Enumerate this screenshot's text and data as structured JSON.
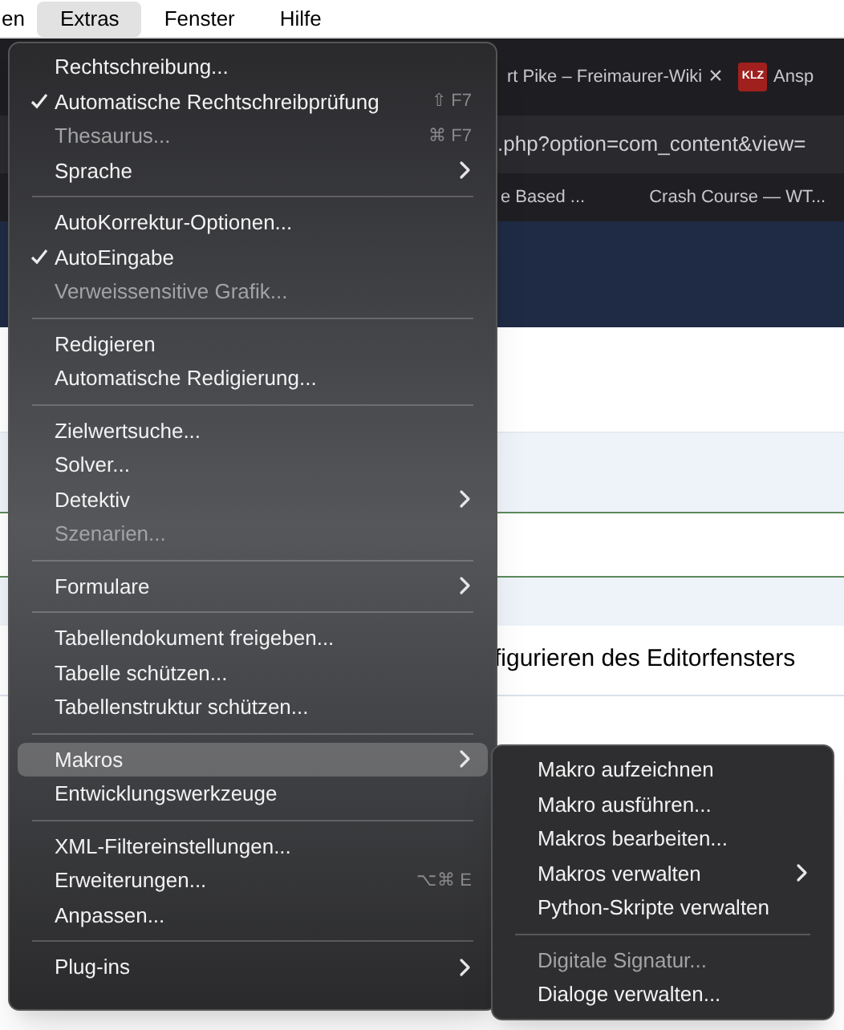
{
  "menubar": [
    {
      "label": "en",
      "selected": false
    },
    {
      "label": "Extras",
      "selected": true
    },
    {
      "label": "Fenster",
      "selected": false
    },
    {
      "label": "Hilfe",
      "selected": false
    }
  ],
  "browser": {
    "tabs": [
      {
        "kind": "text",
        "label": "rt Pike – Freimaurer-Wiki",
        "close": "×"
      },
      {
        "kind": "logo",
        "badge": "KLZ",
        "label": "Ansp"
      }
    ],
    "url": ".php?option=com_content&view=",
    "bookmarks": [
      "e Based ...",
      "Crash Course — WT..."
    ],
    "page_text": "figurieren des Editorfensters"
  },
  "menu": {
    "items": [
      {
        "kind": "item",
        "label": "Rechtschreibung...",
        "checked": false,
        "disabled": false,
        "selected": false,
        "submenu": false
      },
      {
        "kind": "item",
        "label": "Automatische Rechtschreibprüfung",
        "checked": true,
        "disabled": false,
        "selected": false,
        "submenu": false,
        "shortcut": "⇧ F7"
      },
      {
        "kind": "item",
        "label": "Thesaurus...",
        "checked": false,
        "disabled": true,
        "selected": false,
        "submenu": false,
        "shortcut": "⌘ F7"
      },
      {
        "kind": "item",
        "label": "Sprache",
        "checked": false,
        "disabled": false,
        "selected": false,
        "submenu": true
      },
      {
        "kind": "separator"
      },
      {
        "kind": "item",
        "label": "AutoKorrektur-Optionen...",
        "checked": false,
        "disabled": false,
        "selected": false,
        "submenu": false
      },
      {
        "kind": "item",
        "label": "AutoEingabe",
        "checked": true,
        "disabled": false,
        "selected": false,
        "submenu": false
      },
      {
        "kind": "item",
        "label": "Verweissensitive Grafik...",
        "checked": false,
        "disabled": true,
        "selected": false,
        "submenu": false
      },
      {
        "kind": "separator"
      },
      {
        "kind": "item",
        "label": "Redigieren",
        "checked": false,
        "disabled": false,
        "selected": false,
        "submenu": false
      },
      {
        "kind": "item",
        "label": "Automatische Redigierung...",
        "checked": false,
        "disabled": false,
        "selected": false,
        "submenu": false
      },
      {
        "kind": "separator"
      },
      {
        "kind": "item",
        "label": "Zielwertsuche...",
        "checked": false,
        "disabled": false,
        "selected": false,
        "submenu": false
      },
      {
        "kind": "item",
        "label": "Solver...",
        "checked": false,
        "disabled": false,
        "selected": false,
        "submenu": false
      },
      {
        "kind": "item",
        "label": "Detektiv",
        "checked": false,
        "disabled": false,
        "selected": false,
        "submenu": true
      },
      {
        "kind": "item",
        "label": "Szenarien...",
        "checked": false,
        "disabled": true,
        "selected": false,
        "submenu": false
      },
      {
        "kind": "separator"
      },
      {
        "kind": "item",
        "label": "Formulare",
        "checked": false,
        "disabled": false,
        "selected": false,
        "submenu": true
      },
      {
        "kind": "separator"
      },
      {
        "kind": "item",
        "label": "Tabellendokument freigeben...",
        "checked": false,
        "disabled": false,
        "selected": false,
        "submenu": false
      },
      {
        "kind": "item",
        "label": "Tabelle schützen...",
        "checked": false,
        "disabled": false,
        "selected": false,
        "submenu": false
      },
      {
        "kind": "item",
        "label": "Tabellenstruktur schützen...",
        "checked": false,
        "disabled": false,
        "selected": false,
        "submenu": false
      },
      {
        "kind": "separator"
      },
      {
        "kind": "item",
        "label": "Makros",
        "checked": false,
        "disabled": false,
        "selected": true,
        "submenu": true
      },
      {
        "kind": "item",
        "label": "Entwicklungswerkzeuge",
        "checked": false,
        "disabled": false,
        "selected": false,
        "submenu": false
      },
      {
        "kind": "separator"
      },
      {
        "kind": "item",
        "label": "XML-Filtereinstellungen...",
        "checked": false,
        "disabled": false,
        "selected": false,
        "submenu": false
      },
      {
        "kind": "item",
        "label": "Erweiterungen...",
        "checked": false,
        "disabled": false,
        "selected": false,
        "submenu": false,
        "shortcut": "⌥⌘ E"
      },
      {
        "kind": "item",
        "label": "Anpassen...",
        "checked": false,
        "disabled": false,
        "selected": false,
        "submenu": false
      },
      {
        "kind": "separator"
      },
      {
        "kind": "item",
        "label": "Plug-ins",
        "checked": false,
        "disabled": false,
        "selected": false,
        "submenu": true
      }
    ]
  },
  "submenu": {
    "items": [
      {
        "kind": "item",
        "label": "Makro aufzeichnen",
        "disabled": false,
        "submenu": false
      },
      {
        "kind": "item",
        "label": "Makro ausführen...",
        "disabled": false,
        "submenu": false
      },
      {
        "kind": "item",
        "label": "Makros bearbeiten...",
        "disabled": false,
        "submenu": false
      },
      {
        "kind": "item",
        "label": "Makros verwalten",
        "disabled": false,
        "submenu": true
      },
      {
        "kind": "item",
        "label": "Python-Skripte verwalten",
        "disabled": false,
        "submenu": false
      },
      {
        "kind": "separator"
      },
      {
        "kind": "item",
        "label": "Digitale Signatur...",
        "disabled": true,
        "submenu": false
      },
      {
        "kind": "item",
        "label": "Dialoge verwalten...",
        "disabled": false,
        "submenu": false
      }
    ]
  }
}
